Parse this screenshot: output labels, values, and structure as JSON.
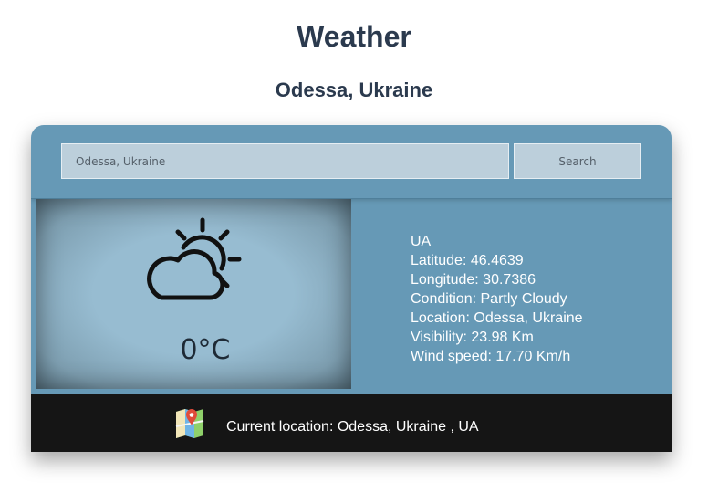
{
  "header": {
    "title": "Weather",
    "location_heading": "Odessa, Ukraine"
  },
  "search": {
    "placeholder": "Odessa, Ukraine",
    "button_label": "Search"
  },
  "current": {
    "icon": "partly-cloudy-icon",
    "temperature": "0°C"
  },
  "details": {
    "country": "UA",
    "latitude": "Latitude: 46.4639",
    "longitude": "Longitude: 30.7386",
    "condition": "Condition: Partly Cloudy",
    "location": "Location: Odessa, Ukraine",
    "visibility": "Visibility: 23.98 Km",
    "wind_speed": "Wind speed: 17.70 Km/h"
  },
  "footer": {
    "icon": "map-pin-icon",
    "current_location": "Current location: Odessa, Ukraine , UA"
  },
  "colors": {
    "card_background": "#6699b6",
    "input_background": "#bccfdb",
    "footer_background": "#151515",
    "heading": "#2b3a4e"
  }
}
